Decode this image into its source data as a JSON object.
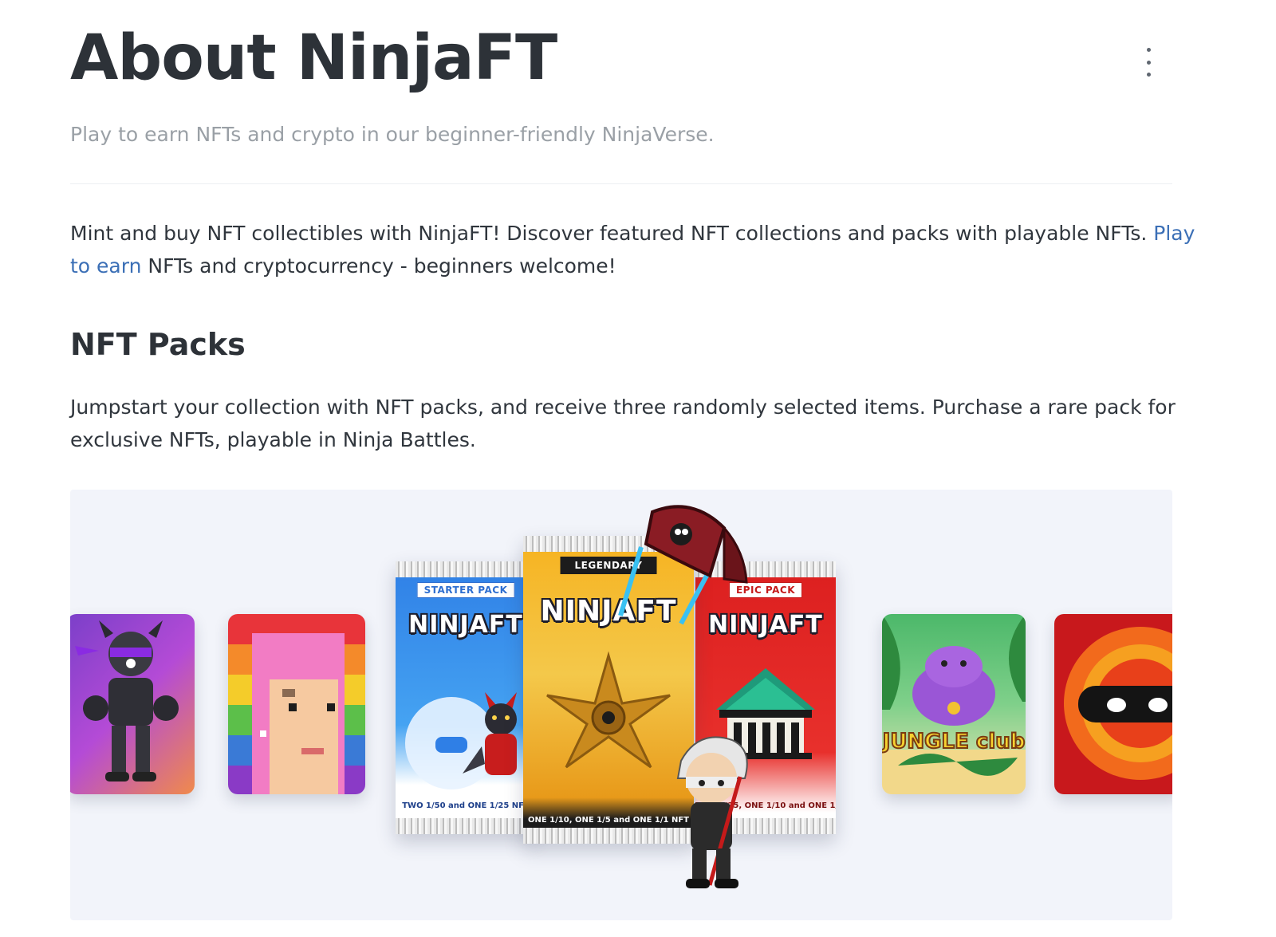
{
  "header": {
    "title": "About NinjaFT",
    "subtitle": "Play to earn NFTs and crypto in our beginner-friendly NinjaVerse."
  },
  "intro": {
    "text_before": "Mint and buy NFT collectibles with NinjaFT! Discover featured NFT collections and packs with playable NFTs. ",
    "link_text": "Play to earn",
    "text_after": " NFTs and cryptocurrency - beginners welcome!"
  },
  "packs_section": {
    "heading": "NFT Packs",
    "description": "Jumpstart your collection with NFT packs, and receive three randomly selected items. Purchase a rare pack for exclusive NFTs, playable in Ninja Battles."
  },
  "showcase": {
    "packs": [
      {
        "label": "STARTER PACK",
        "logo": "NINJAFT",
        "footer": "TWO 1/50 and ONE 1/25 NFT",
        "color": "#2f7fe6"
      },
      {
        "label": "LEGENDARY",
        "logo": "NINJAFT",
        "footer": "ONE 1/10, ONE 1/5 and ONE 1/1 NFT",
        "color": "#f0a820"
      },
      {
        "label": "EPIC PACK",
        "logo": "NINJAFT",
        "footer": "TWO 1/25, ONE 1/10 and ONE 1/5 NFT",
        "color": "#dc1f1f"
      }
    ],
    "side_cards": [
      {
        "icon": "armored-ninja-nft-icon"
      },
      {
        "icon": "pixel-punk-nft-icon"
      },
      {
        "icon": "jungle-club-nft-icon",
        "text": "JUNGLE club"
      },
      {
        "icon": "fire-ninja-nft-icon"
      }
    ]
  }
}
